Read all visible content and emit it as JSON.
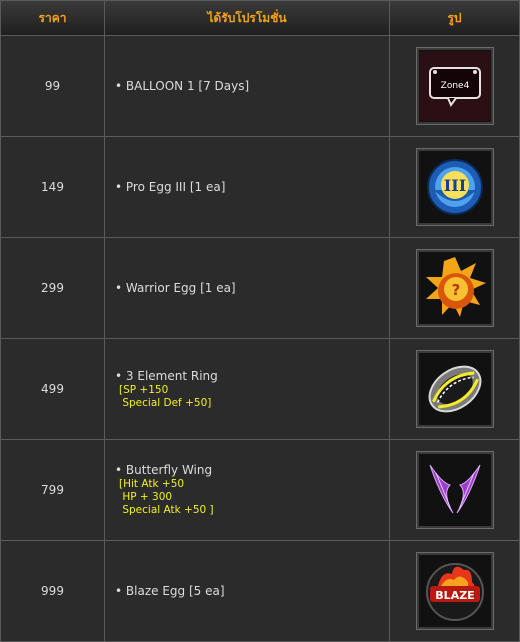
{
  "header": {
    "col_price": "ราคา",
    "col_promo": "ได้รับโปรโมชั่น",
    "col_image": "รูป"
  },
  "rows": [
    {
      "price": "99",
      "item": "BALLOON 1 [7 Days]",
      "stats": [],
      "icon": "zone4-balloon-icon",
      "icon_text": "Zone4"
    },
    {
      "price": "149",
      "item": "Pro Egg III [1 ea]",
      "stats": [],
      "icon": "pro-egg-iii-icon",
      "icon_text": "III"
    },
    {
      "price": "299",
      "item": "Warrior Egg [1 ea]",
      "stats": [],
      "icon": "warrior-egg-icon"
    },
    {
      "price": "499",
      "item": "3 Element Ring",
      "stats": [
        "[SP +150",
        " Special Def +50]"
      ],
      "icon": "element-ring-icon"
    },
    {
      "price": "799",
      "item": "Butterfly Wing",
      "stats": [
        "[Hit Atk +50",
        " HP + 300",
        " Special Atk +50 ]"
      ],
      "icon": "butterfly-wing-icon"
    },
    {
      "price": "999",
      "item": "Blaze Egg [5 ea]",
      "stats": [],
      "icon": "blaze-egg-icon",
      "icon_text": "BLAZE"
    }
  ],
  "colors": {
    "header_text": "#f3a21b",
    "stat_text": "#f2ef27",
    "body_text": "#dcdcdc",
    "border": "#5a5a5a"
  }
}
